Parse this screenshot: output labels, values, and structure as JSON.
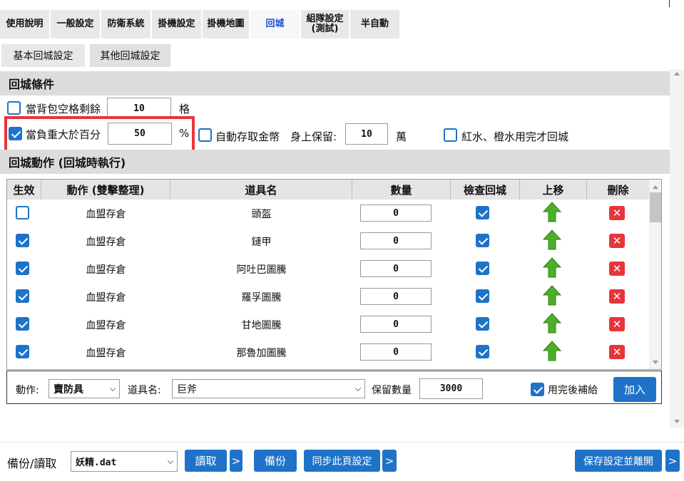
{
  "tabs": [
    {
      "label": "使用說明"
    },
    {
      "label": "一般設定"
    },
    {
      "label": "防衛系統"
    },
    {
      "label": "掛機設定"
    },
    {
      "label": "掛機地圖"
    },
    {
      "label": "回城"
    },
    {
      "label": "組隊設定\n(測試)"
    },
    {
      "label": "半自動"
    }
  ],
  "subtabs": [
    {
      "label": "基本回城設定"
    },
    {
      "label": "其他回城設定"
    }
  ],
  "conditions": {
    "title": "回城條件",
    "bag_label": "當背包空格剩餘",
    "bag_value": "10",
    "bag_unit": "格",
    "weight_label": "當負重大於百分",
    "weight_value": "50",
    "weight_unit": "%",
    "auto_store_label": "自動存取金幣",
    "keep_label": "身上保留:",
    "keep_value": "10",
    "keep_unit": "萬",
    "potion_label": "紅水、橙水用完才回城"
  },
  "actions": {
    "title": "回城動作 (回城時執行)",
    "columns": [
      "生效",
      "動作 (雙擊整理)",
      "道具名",
      "數量",
      "檢查回城",
      "上移",
      "刪除"
    ],
    "rows": [
      {
        "enabled": false,
        "action": "血盟存倉",
        "item": "頭盔",
        "qty": "0",
        "check": true
      },
      {
        "enabled": true,
        "action": "血盟存倉",
        "item": "鏈甲",
        "qty": "0",
        "check": true
      },
      {
        "enabled": true,
        "action": "血盟存倉",
        "item": "阿吐巴圖騰",
        "qty": "0",
        "check": true
      },
      {
        "enabled": true,
        "action": "血盟存倉",
        "item": "羅孚圖騰",
        "qty": "0",
        "check": true
      },
      {
        "enabled": true,
        "action": "血盟存倉",
        "item": "甘地圖騰",
        "qty": "0",
        "check": true
      },
      {
        "enabled": true,
        "action": "血盟存倉",
        "item": "那魯加圖騰",
        "qty": "0",
        "check": true
      }
    ]
  },
  "editor": {
    "action_label": "動作:",
    "action_value": "賣防具",
    "item_label": "道具名:",
    "item_value": "巨斧",
    "keep_label": "保留數量",
    "keep_value": "3000",
    "refill_label": "用完後補給",
    "add_label": "加入"
  },
  "footer": {
    "backup_label": "備份/讀取",
    "file_value": "妖精.dat",
    "read_label": "讀取",
    "more": ">",
    "backup_btn": "備份",
    "sync_label": "同步此頁設定",
    "save_exit_label": "保存設定並離開"
  },
  "colors": {
    "accent": "#1e73c8",
    "highlight": "#e8343b",
    "arrow": "#4caf28"
  }
}
